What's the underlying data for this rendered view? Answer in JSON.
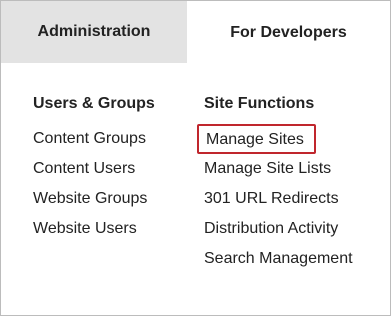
{
  "tabs": [
    {
      "label": "Administration",
      "active": true
    },
    {
      "label": "For Developers",
      "active": false
    }
  ],
  "users_groups": {
    "header": "Users & Groups",
    "items": [
      "Content Groups",
      "Content Users",
      "Website Groups",
      "Website Users"
    ]
  },
  "site_functions": {
    "header": "Site Functions",
    "items": [
      "Manage Sites",
      "Manage Site Lists",
      "301 URL Redirects",
      "Distribution Activity",
      "Search Management"
    ],
    "highlighted_item": "Manage Sites"
  },
  "colors": {
    "highlight_border": "#c0262d",
    "active_tab_bg": "#e3e3e3",
    "inactive_tab_bg": "#ffffff"
  }
}
